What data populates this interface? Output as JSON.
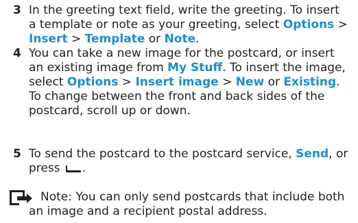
{
  "steps": [
    {
      "number": "3",
      "lines": [
        {
          "t1": "In the greeting text field, write the greeting. To insert"
        },
        {
          "t1": "a template or note as your greeting, select ",
          "k1": "Options",
          "t2": " >"
        },
        {
          "k1": "Insert",
          "t1": " > ",
          "k2": "Template",
          "t2": " or ",
          "k3": "Note",
          "t3": "."
        }
      ]
    },
    {
      "number": "4",
      "lines": [
        {
          "t1": "You can take a new image for the postcard, or insert"
        },
        {
          "t1": "an existing image from ",
          "k1": "My Stuff",
          "t2": ". To insert the image,"
        },
        {
          "t1": "select ",
          "k1": "Options",
          "t2": " > ",
          "k2": "Insert image",
          "t3": " > ",
          "k3": "New",
          "t4": " or ",
          "k4": "Existing",
          "t5": "."
        },
        {
          "t1": "To change between the front and back sides of the"
        },
        {
          "t1": "postcard, scroll up or down."
        }
      ]
    },
    {
      "number": "5",
      "lines": [
        {
          "t1": "To send the postcard to the postcard service, ",
          "k1": "Send",
          "t2": ", or"
        },
        {
          "t1": "press",
          "icon": "call-key-icon",
          "t2": "."
        }
      ]
    }
  ],
  "note": {
    "icon": "note-icon",
    "line1": "Note: You can only send postcards that include both",
    "line2": "an image and a recipient postal address."
  }
}
